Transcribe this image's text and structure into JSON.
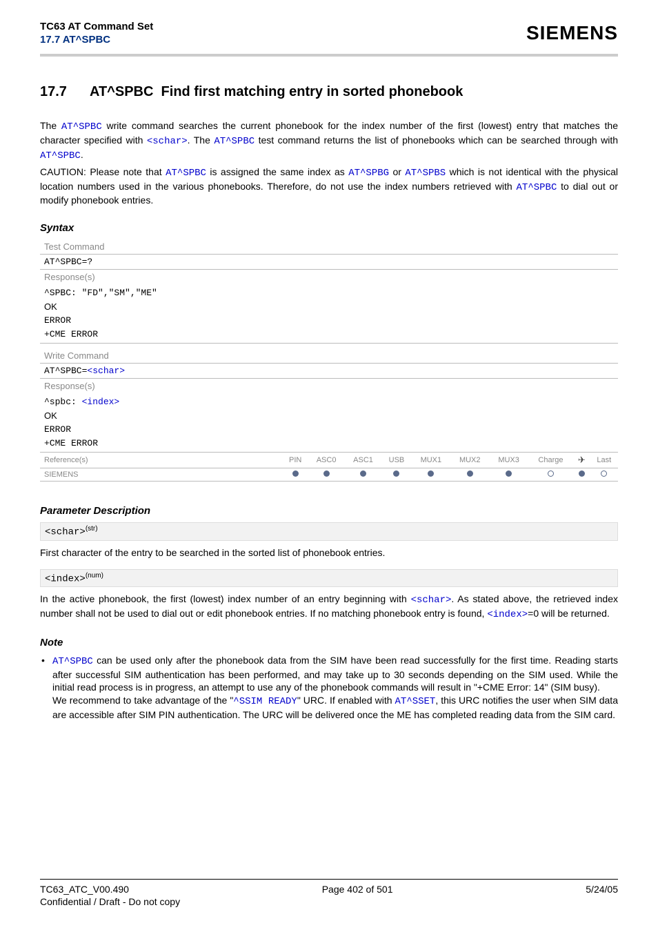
{
  "header": {
    "doc_title": "TC63 AT Command Set",
    "doc_subtitle": "17.7 AT^SPBC",
    "brand": "SIEMENS"
  },
  "section": {
    "number": "17.7",
    "cmd": "AT^SPBC",
    "title_rest": "Find first matching entry in sorted phonebook"
  },
  "intro": {
    "p1_a": "The ",
    "p1_cmd": "AT^SPBC",
    "p1_b": " write command searches the current phonebook for the index number of the first (lowest) entry that matches the character specified with ",
    "p1_schar": "<schar>",
    "p1_c": ". The ",
    "p1_cmd2": "AT^SPBC",
    "p1_d": " test command returns the list of phonebooks which can be searched through with ",
    "p1_cmd3": "AT^SPBC",
    "p1_e": ".",
    "p2_a": "CAUTION: Please note that ",
    "p2_cmd1": "AT^SPBC",
    "p2_b": " is assigned the same index as ",
    "p2_cmd2": "AT^SPBG",
    "p2_c": " or ",
    "p2_cmd3": "AT^SPBS",
    "p2_d": " which is not identical with the physical location numbers used in the various phonebooks. Therefore, do not use the index numbers retrieved with ",
    "p2_cmd4": "AT^SPBC",
    "p2_e": " to dial out or modify phonebook entries."
  },
  "syntax_label": "Syntax",
  "syntax": {
    "test_label": "Test Command",
    "test_cmd": "AT^SPBC=?",
    "resp_label": "Response(s)",
    "test_resp_l1": "^SPBC: \"FD\",\"SM\",\"ME\"",
    "ok": "OK",
    "error": "ERROR",
    "cme": "+CME ERROR",
    "write_label": "Write Command",
    "write_cmd_a": "AT^SPBC=",
    "write_cmd_b": "<schar>",
    "write_resp_a": "^spbc: ",
    "write_resp_b": "<index>",
    "ref_label": "Reference(s)",
    "ref_value": "SIEMENS",
    "cols": [
      "PIN",
      "ASC0",
      "ASC1",
      "USB",
      "MUX1",
      "MUX2",
      "MUX3",
      "Charge",
      "",
      "Last"
    ],
    "arrow": "✈",
    "row": [
      "filled",
      "filled",
      "filled",
      "filled",
      "filled",
      "filled",
      "filled",
      "open",
      "filled",
      "open"
    ]
  },
  "param_label": "Parameter Description",
  "params": {
    "schar_name": "<schar>",
    "schar_type": "(str)",
    "schar_desc": "First character of the entry to be searched in the sorted list of phonebook entries.",
    "index_name": "<index>",
    "index_type": "(num)",
    "index_desc_a": "In the active phonebook, the first (lowest) index number of an entry beginning with ",
    "index_desc_schar": "<schar>",
    "index_desc_b": ". As stated above, the retrieved index number shall not be used to dial out or edit phonebook entries. If no matching phonebook entry is found, ",
    "index_desc_idx": "<index>",
    "index_desc_c": "=0 will be returned."
  },
  "note_label": "Note",
  "note": {
    "a": "AT^SPBC",
    "b": " can be used only after the phonebook data from the SIM have been read successfully for the first time. Reading starts after successful SIM authentication has been performed, and may take up to 30 seconds depending on the SIM used. While the initial read process is in progress, an attempt to use any of the phonebook commands will result in \"+CME Error: 14\" (SIM busy).",
    "c": "We recommend to take advantage of the \"",
    "d": "^SSIM READY",
    "e": "\" URC. If enabled with ",
    "f": "AT^SSET",
    "g": ", this URC notifies the user when SIM data are accessible after SIM PIN authentication. The URC will be delivered once the ME has completed reading data from the SIM card."
  },
  "footer": {
    "left": "TC63_ATC_V00.490",
    "center": "Page 402 of 501",
    "right": "5/24/05",
    "conf": "Confidential / Draft - Do not copy"
  }
}
